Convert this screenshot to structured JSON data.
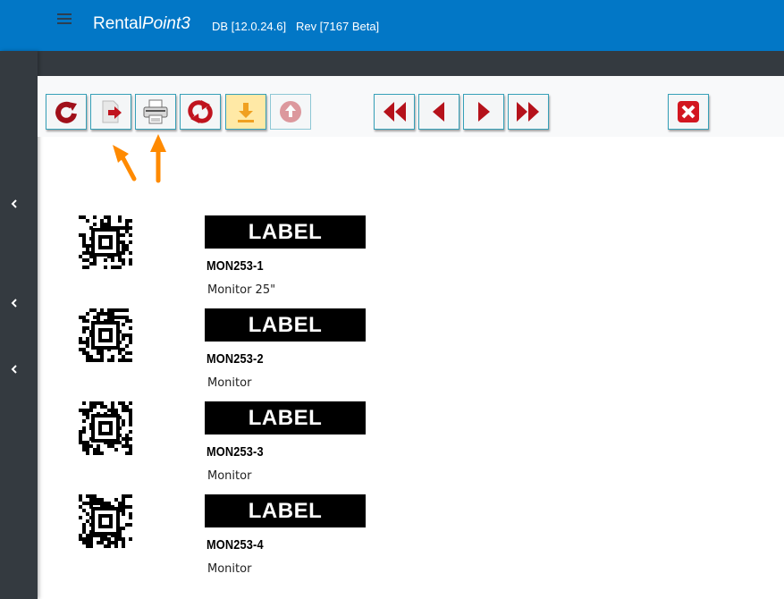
{
  "header": {
    "app_name_plain": "Rental",
    "app_name_italic": "Point3",
    "db_info": "DB [12.0.24.6]   Rev [7167 Beta]"
  },
  "sidebar": {
    "collapse_icons": [
      "chevron-left-icon",
      "chevron-left-icon",
      "chevron-left-icon"
    ]
  },
  "toolbar": {
    "buttons": [
      {
        "name": "refresh-button",
        "icon": "refresh-icon",
        "enabled": true
      },
      {
        "name": "export-button",
        "icon": "export-icon",
        "enabled": true
      },
      {
        "name": "print-button",
        "icon": "printer-icon",
        "enabled": true
      },
      {
        "name": "sync-button",
        "icon": "sync-icon",
        "enabled": true
      },
      {
        "name": "download-button",
        "icon": "download-icon",
        "enabled": true
      },
      {
        "name": "upload-button",
        "icon": "upload-icon",
        "enabled": false
      },
      {
        "name": "first-page-button",
        "icon": "double-chevron-left-icon",
        "enabled": true
      },
      {
        "name": "prev-page-button",
        "icon": "triangle-left-icon",
        "enabled": true
      },
      {
        "name": "next-page-button",
        "icon": "triangle-right-icon",
        "enabled": true
      },
      {
        "name": "last-page-button",
        "icon": "double-chevron-right-icon",
        "enabled": true
      },
      {
        "name": "close-button",
        "icon": "close-icon",
        "enabled": true
      }
    ]
  },
  "labels": [
    {
      "banner": "LABEL",
      "code": "MON253-1",
      "description": "Monitor 25\""
    },
    {
      "banner": "LABEL",
      "code": "MON253-2",
      "description": "Monitor"
    },
    {
      "banner": "LABEL",
      "code": "MON253-3",
      "description": "Monitor"
    },
    {
      "banner": "LABEL",
      "code": "MON253-4",
      "description": "Monitor"
    }
  ],
  "colors": {
    "header_blue": "#0277c6",
    "sidebar_dark": "#343a40",
    "button_border": "#36a0b8",
    "icon_red": "#b5121b",
    "annotation_orange": "#ff8a00"
  }
}
